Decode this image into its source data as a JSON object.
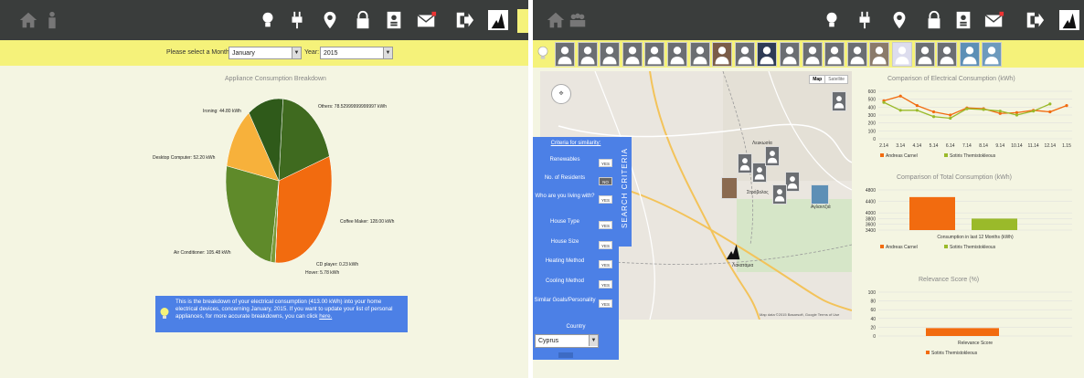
{
  "left": {
    "month_label": "Please select a Month:",
    "month_value": "January",
    "year_label": "Year:",
    "year_value": "2015",
    "title": "Appliance Consumption Breakdown",
    "info_pre": "This is the breakdown of your electrical consumption (413.00 kWh) into your home electrical devices, concerning January, 2015. If you want to update your list of personal appliances, for more accurate breakdowns, you can click",
    "info_link": "here.",
    "info_end": ""
  },
  "nav_icons": [
    "home-icon",
    "person-icon",
    "lightbulb-icon",
    "plug-icon",
    "location-pin-icon",
    "lock-icon",
    "id-card-icon",
    "mail-icon",
    "logout-icon",
    "avatar-icon"
  ],
  "right": {
    "criteria_link": "Criteria for similarity:",
    "vertical_label": "SEARCH CRITERIA",
    "criteria": [
      {
        "label": "Renewables",
        "toggle": "YES"
      },
      {
        "label": "No. of Residents",
        "toggle": "NO"
      },
      {
        "label": "Who are you living with?",
        "toggle": "YES"
      },
      {
        "label": "House Type",
        "toggle": "YES"
      },
      {
        "label": "House Size",
        "toggle": "YES"
      },
      {
        "label": "Heating Method",
        "toggle": "YES"
      },
      {
        "label": "Cooling Method",
        "toggle": "YES"
      },
      {
        "label": "Similar Goals/Personality",
        "toggle": "YES"
      }
    ],
    "country_label": "Country",
    "country_value": "Cyprus",
    "map_btn": "Map",
    "sat_btn": "Satellite",
    "map_places": [
      "Αγλαντζιά",
      "Στρόβολος",
      "Λακατάμια",
      "Λευκωσία"
    ],
    "map_footer": "Map data ©2015 Basarsoft, Google   Terms of Use"
  },
  "chart_data": [
    {
      "type": "pie",
      "title": "Appliance Consumption Breakdown",
      "slices": [
        {
          "label": "Others: 78.52999999999997 kWh",
          "value": 78.53,
          "color": "#3f6a1f"
        },
        {
          "label": "Coffee Maker: 128.00 kWh",
          "value": 128.0,
          "color": "#f26b0f"
        },
        {
          "label": "CD player: 0.23 kWh",
          "value": 0.23,
          "color": "#c8c8c8"
        },
        {
          "label": "Hover: 5.78 kWh",
          "value": 5.78,
          "color": "#7a9a3a"
        },
        {
          "label": "Air Conditioner: 105.48 kWh",
          "value": 105.48,
          "color": "#5f8a2a"
        },
        {
          "label": "Desktop Computer: 52.20 kWh",
          "value": 52.2,
          "color": "#f7b13b"
        },
        {
          "label": "Ironing: 44.80 kWh",
          "value": 44.8,
          "color": "#2f5a1a"
        }
      ]
    },
    {
      "type": "line",
      "title": "Comparison of Electrical Consumption (kWh)",
      "x": [
        "2.14",
        "3.14",
        "4.14",
        "5.14",
        "6.14",
        "7.14",
        "8.14",
        "9.14",
        "10.14",
        "11.14",
        "12.14",
        "1.15"
      ],
      "ylim": [
        0,
        600
      ],
      "yticks": [
        "600",
        "500",
        "400",
        "300",
        "200",
        "100",
        "0"
      ],
      "series": [
        {
          "name": "Andreas Carnel",
          "color": "#f26b0f",
          "values": [
            480,
            540,
            420,
            340,
            300,
            390,
            380,
            320,
            330,
            360,
            340,
            420
          ]
        },
        {
          "name": "Sotiris Themistokleous",
          "color": "#9aba2a",
          "values": [
            460,
            360,
            360,
            280,
            260,
            380,
            370,
            350,
            300,
            350,
            440,
            null
          ]
        }
      ]
    },
    {
      "type": "bar",
      "title": "Comparison of Total Consumption (kWh)",
      "categories": [
        "Consumption in last 12 Months (kWh)"
      ],
      "ylim": [
        3400,
        4800
      ],
      "yticks": [
        "4800",
        "4400",
        "4000",
        "3800",
        "3600",
        "3400"
      ],
      "series": [
        {
          "name": "Andreas Carnel",
          "color": "#f26b0f",
          "values": [
            4550
          ]
        },
        {
          "name": "Sotiris Themistokleous",
          "color": "#9aba2a",
          "values": [
            3800
          ]
        }
      ]
    },
    {
      "type": "bar",
      "title": "Relevance Score (%)",
      "categories": [
        "Relevance Score"
      ],
      "ylim": [
        0,
        100
      ],
      "yticks": [
        "100",
        "80",
        "60",
        "40",
        "20",
        "0"
      ],
      "series": [
        {
          "name": "Sotiris Themistokleous",
          "color": "#f26b0f",
          "values": [
            18
          ]
        }
      ]
    }
  ]
}
